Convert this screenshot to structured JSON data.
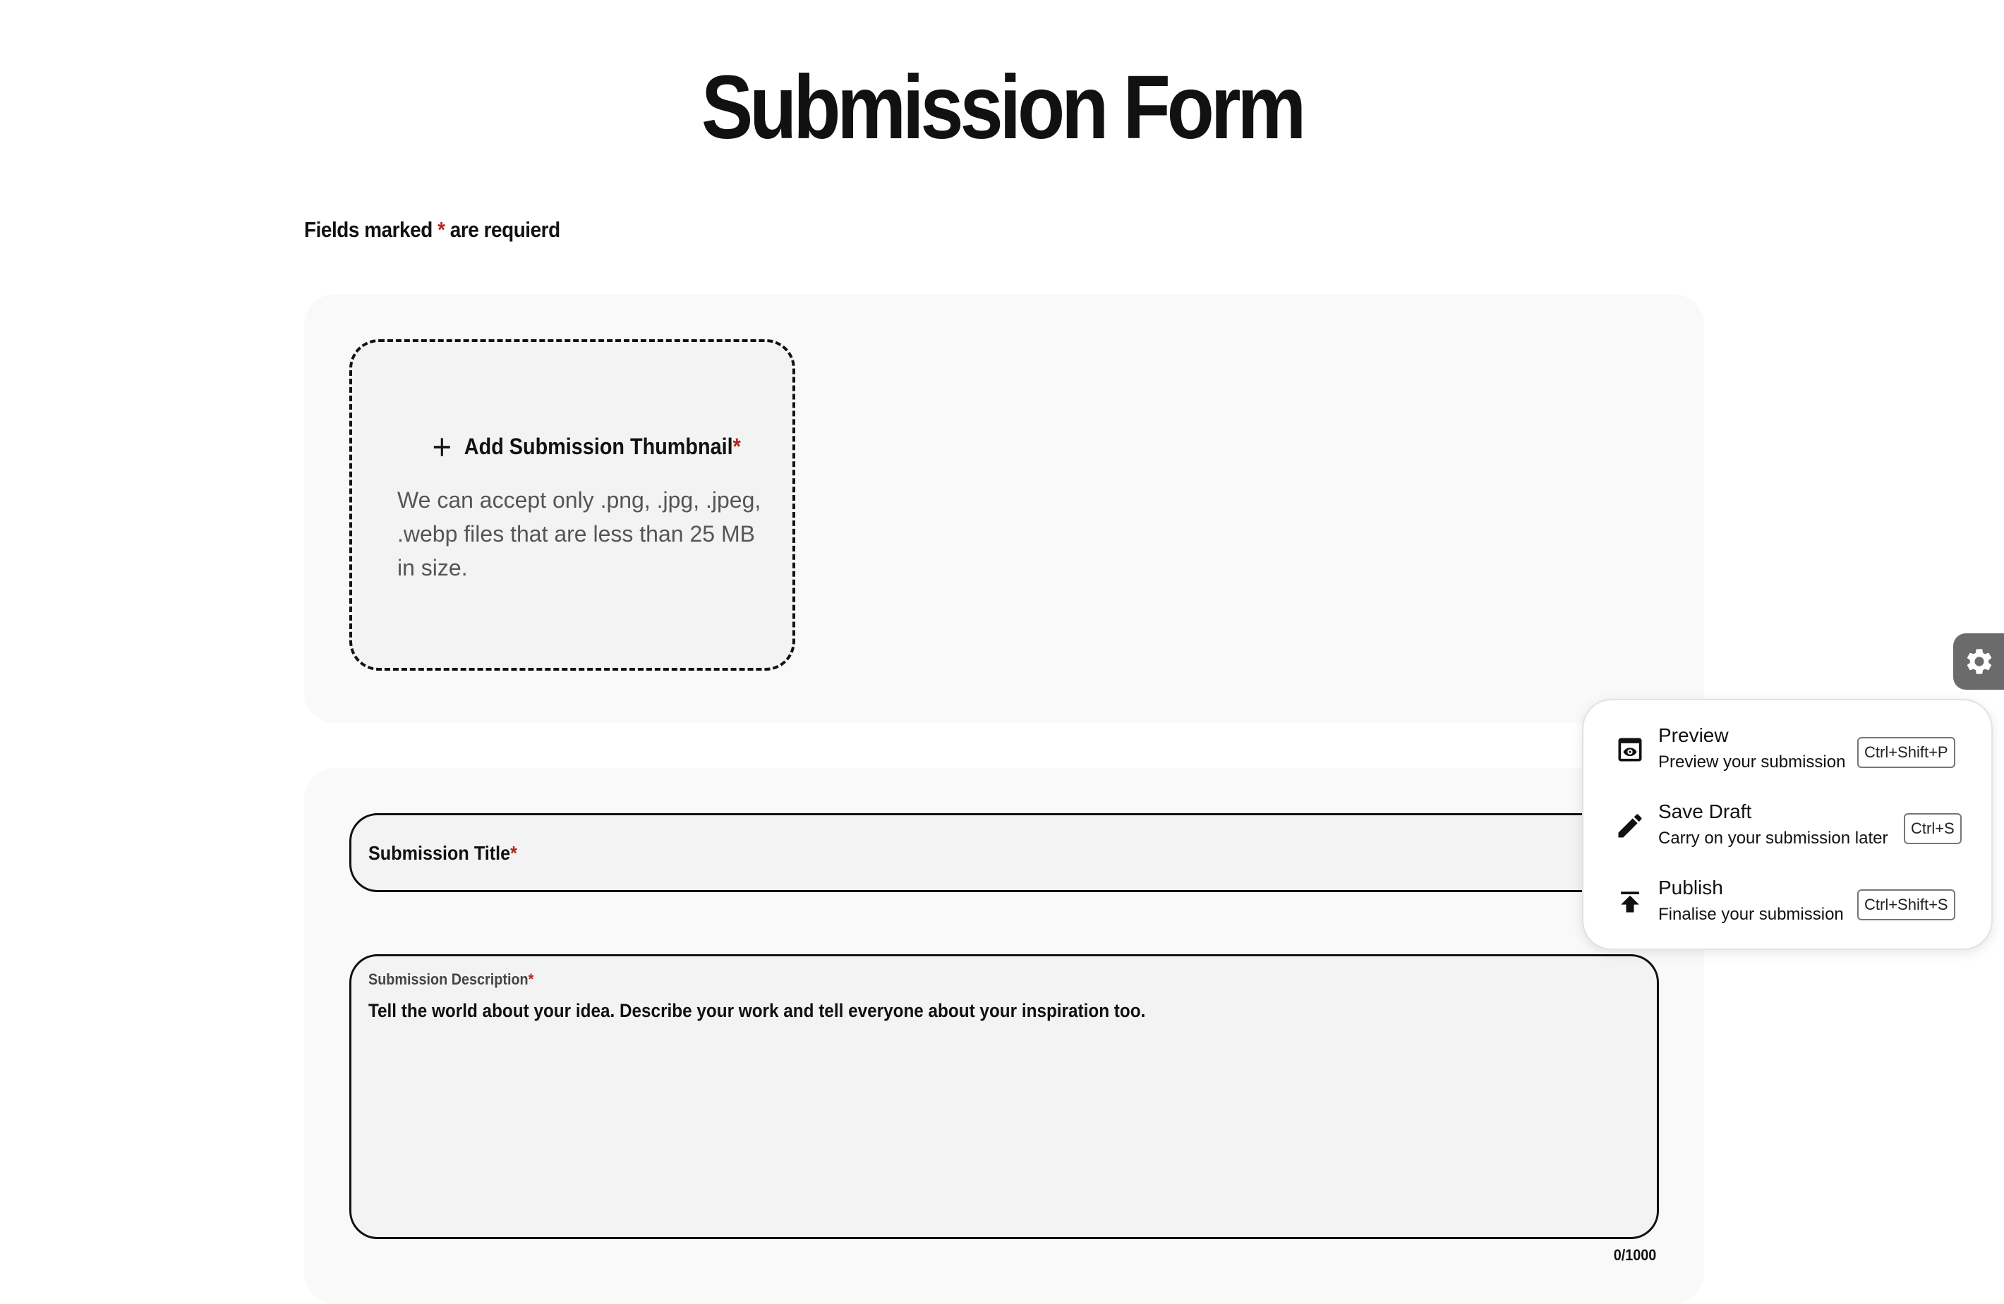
{
  "page": {
    "title": "Submission Form"
  },
  "required_note": {
    "prefix": "Fields marked ",
    "star": "*",
    "suffix": " are requierd"
  },
  "thumbnail": {
    "heading": "Add Submission Thumbnail",
    "star": "*",
    "help": "We can accept only .png, .jpg, .jpeg, .webp files that are less than 25 MB in size.",
    "icon": "plus-icon"
  },
  "title_field": {
    "label": "Submission Title",
    "star": "*"
  },
  "description_field": {
    "label": "Submission Description",
    "star": "*",
    "placeholder": "Tell the world about your idea. Describe your work and tell everyone about your inspiration too.",
    "counter": "0/1000"
  },
  "settings": {
    "icon": "gear-icon"
  },
  "menu": {
    "items": [
      {
        "title": "Preview",
        "subtitle": "Preview your submission",
        "shortcut": "Ctrl+Shift+P",
        "icon": "preview-icon"
      },
      {
        "title": "Save Draft",
        "subtitle": "Carry on your submission later",
        "shortcut": "Ctrl+S",
        "icon": "pencil-icon"
      },
      {
        "title": "Publish",
        "subtitle": "Finalise your submission",
        "shortcut": "Ctrl+Shift+S",
        "icon": "publish-icon"
      }
    ]
  },
  "colors": {
    "required_star": "#b3261e",
    "card_bg": "#f9f9f9",
    "field_bg": "#f3f3f3",
    "settings_tab": "#6b6b6b"
  }
}
